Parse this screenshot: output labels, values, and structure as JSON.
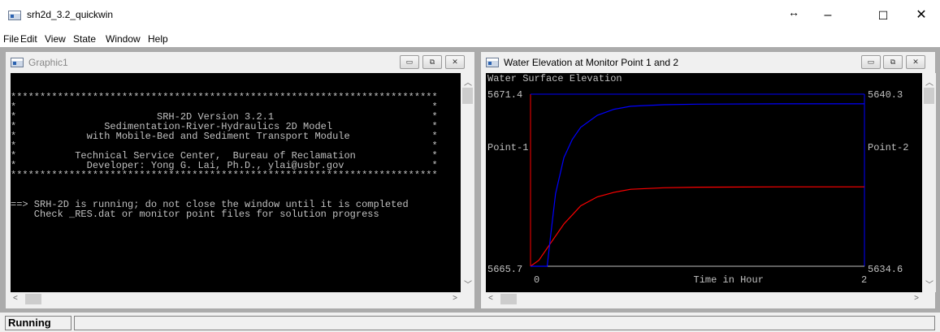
{
  "window": {
    "title": "srh2d_3.2_quickwin",
    "resize_glyph": "↔",
    "minimize": "–",
    "maximize": "☐",
    "close": "✕"
  },
  "menu": [
    "File",
    "Edit",
    "View",
    "State",
    "Window",
    "Help"
  ],
  "left_window": {
    "title": "Graphic1",
    "lines": [
      "",
      "",
      "*************************************************************************",
      "*                                                                       *",
      "*                        SRH-2D Version 3.2.1                           *",
      "*               Sedimentation-River-Hydraulics 2D Model                 *",
      "*            with Mobile-Bed and Sediment Transport Module              *",
      "*                                                                       *",
      "*          Technical Service Center,  Bureau of Reclamation             *",
      "*            Developer: Yong G. Lai, Ph.D., ylai@usbr.gov               *",
      "*************************************************************************",
      "",
      "",
      "==> SRH-2D is running; do not close the window until it is completed",
      "    Check _RES.dat or monitor point files for solution progress"
    ]
  },
  "right_window": {
    "title": "Water Elevation at Monitor Point 1 and 2",
    "colors": {
      "point1": "#ff0000",
      "point2": "#0000ff",
      "text": "#c0c0c0",
      "background": "#000000"
    }
  },
  "chart_data": {
    "type": "line",
    "title": "Water Surface Elevation",
    "xlabel": "Time in Hour",
    "xlim": [
      0,
      2
    ],
    "x_tick_labels": [
      "0",
      "2"
    ],
    "left_axis": {
      "label": "Point-1",
      "max_label": "5671.4",
      "min_label": "5665.7",
      "ylim": [
        5665.7,
        5671.4
      ]
    },
    "right_axis": {
      "label": "Point-2",
      "max_label": "5640.3",
      "min_label": "5634.6",
      "ylim": [
        5634.6,
        5640.3
      ]
    },
    "series": [
      {
        "axis": "left",
        "color": "#ff0000",
        "x": [
          0,
          0.05,
          0.1,
          0.15,
          0.2,
          0.25,
          0.3,
          0.4,
          0.5,
          0.6,
          0.8,
          1.0,
          1.5,
          2.0
        ],
        "y": [
          5665.7,
          5665.9,
          5666.3,
          5666.7,
          5667.1,
          5667.4,
          5667.7,
          5668.0,
          5668.15,
          5668.25,
          5668.3,
          5668.32,
          5668.33,
          5668.33
        ]
      },
      {
        "axis": "right",
        "color": "#0000ff",
        "x": [
          0,
          0.05,
          0.1,
          0.12,
          0.15,
          0.2,
          0.25,
          0.3,
          0.4,
          0.5,
          0.6,
          0.8,
          1.0,
          1.5,
          2.0
        ],
        "y": [
          5634.6,
          5634.6,
          5634.6,
          5635.6,
          5637.0,
          5638.2,
          5638.8,
          5639.2,
          5639.6,
          5639.8,
          5639.9,
          5639.95,
          5639.97,
          5639.98,
          5639.98
        ]
      }
    ]
  },
  "status": {
    "text": "Running"
  }
}
